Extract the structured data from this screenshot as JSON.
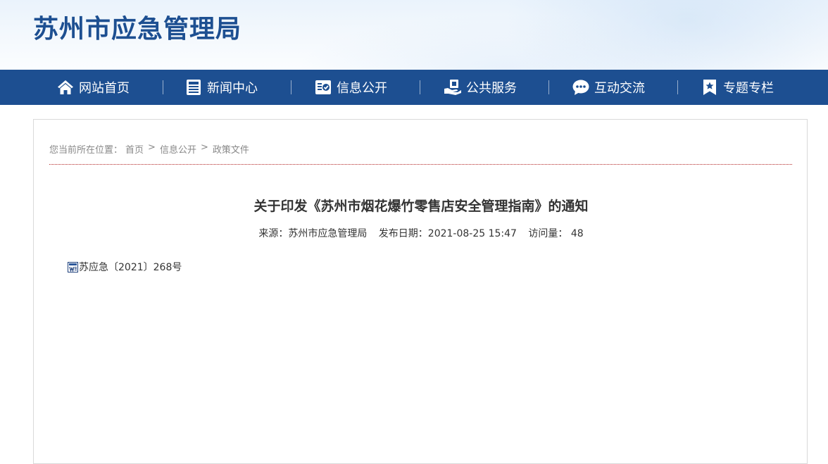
{
  "site": {
    "title": "苏州市应急管理局"
  },
  "nav": {
    "items": [
      {
        "label": "网站首页",
        "icon": "home-icon"
      },
      {
        "label": "新闻中心",
        "icon": "news-icon"
      },
      {
        "label": "信息公开",
        "icon": "info-check-icon"
      },
      {
        "label": "公共服务",
        "icon": "service-hand-icon"
      },
      {
        "label": "互动交流",
        "icon": "chat-icon"
      },
      {
        "label": "专题专栏",
        "icon": "bookmark-star-icon"
      }
    ]
  },
  "breadcrumb": {
    "prefix": "您当前所在位置：",
    "items": [
      "首页",
      "信息公开",
      "政策文件"
    ],
    "separator": ">"
  },
  "article": {
    "title": "关于印发《苏州市烟花爆竹零售店安全管理指南》的通知",
    "source": "来源：苏州市应急管理局",
    "date": "发布日期：2021-08-25 15:47",
    "views": "访问量：  48",
    "attachment": {
      "label": "苏应急〔2021〕268号",
      "icon": "word-doc-icon"
    }
  },
  "colors": {
    "brand": "#1d4f91",
    "divider": "#b22222",
    "text": "#333333",
    "muted": "#888888"
  }
}
